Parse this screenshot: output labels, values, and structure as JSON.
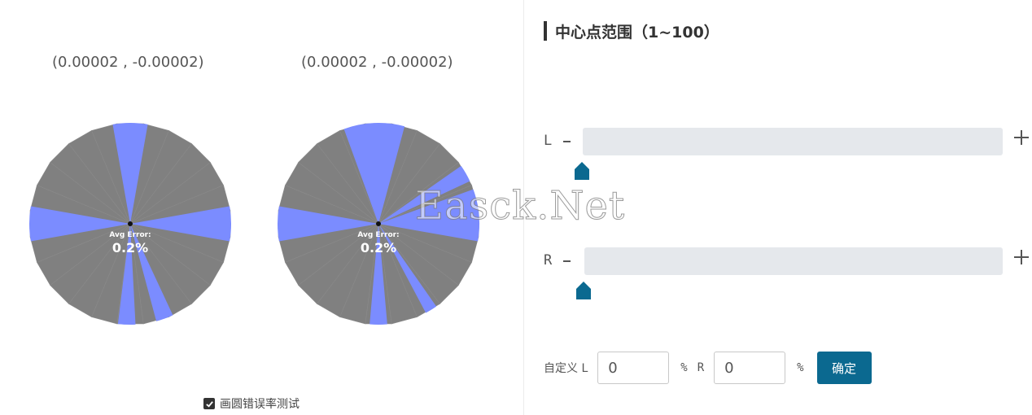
{
  "wheels": [
    {
      "coordinate_label": "(0.00002 , -0.00002)",
      "avg_error_label": "Avg Error:",
      "avg_error_value": "0.2%",
      "base_color": "#808080",
      "highlight_color": "#7b8cff",
      "wedges_deg": [
        [
          350,
          10
        ],
        [
          80,
          100
        ],
        [
          155,
          165
        ],
        [
          177,
          187
        ],
        [
          260,
          280
        ]
      ]
    },
    {
      "coordinate_label": "(0.00002 , -0.00002)",
      "avg_error_label": "Avg Error:",
      "avg_error_value": "0.2%",
      "base_color": "#808080",
      "highlight_color": "#7b8cff",
      "wedges_deg": [
        [
          340,
          15
        ],
        [
          55,
          65
        ],
        [
          70,
          100
        ],
        [
          145,
          152
        ],
        [
          175,
          185
        ],
        [
          260,
          280
        ]
      ]
    }
  ],
  "test_checkbox": {
    "label": "画圆错误率测试",
    "checked": true
  },
  "range_panel": {
    "title": "中心点范围（1~100）",
    "left_slider": {
      "label": "L",
      "value": 0
    },
    "right_slider": {
      "label": "R",
      "value": 0
    }
  },
  "custom": {
    "label": "自定义 L",
    "left_value": "0",
    "percent": "%",
    "r_label": "R",
    "right_value": "0",
    "percent2": "%",
    "confirm_label": "确定"
  },
  "accent_color": "#0b6990",
  "watermark": "Easck.Net"
}
